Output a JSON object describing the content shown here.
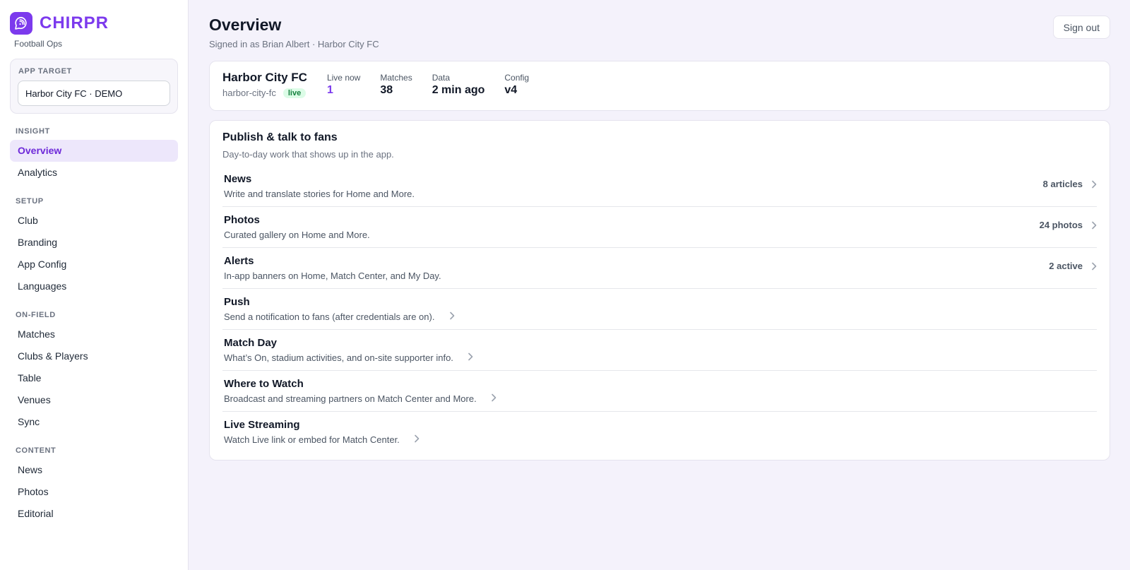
{
  "brand": {
    "name": "CHIRPR",
    "subtitle": "Football Ops",
    "accent": "#7c3aed"
  },
  "app_target": {
    "label": "APP TARGET",
    "value": "Harbor City FC · DEMO"
  },
  "nav": {
    "sections": [
      {
        "title": "INSIGHT",
        "items": [
          {
            "label": "Overview",
            "active": true
          },
          {
            "label": "Analytics"
          }
        ]
      },
      {
        "title": "SETUP",
        "items": [
          {
            "label": "Club"
          },
          {
            "label": "Branding"
          },
          {
            "label": "App Config"
          },
          {
            "label": "Languages"
          }
        ]
      },
      {
        "title": "ON-FIELD",
        "items": [
          {
            "label": "Matches"
          },
          {
            "label": "Clubs & Players"
          },
          {
            "label": "Table"
          },
          {
            "label": "Venues"
          },
          {
            "label": "Sync"
          }
        ]
      },
      {
        "title": "CONTENT",
        "items": [
          {
            "label": "News"
          },
          {
            "label": "Photos"
          },
          {
            "label": "Editorial"
          }
        ]
      }
    ]
  },
  "header": {
    "title": "Overview",
    "subtitle": "Signed in as Brian Albert · Harbor City FC",
    "signout_label": "Sign out"
  },
  "club": {
    "name": "Harbor City FC",
    "slug": "harbor-city-fc",
    "status_badge": "live",
    "stats": [
      {
        "label": "Live now",
        "value": "1",
        "accent": true
      },
      {
        "label": "Matches",
        "value": "38"
      },
      {
        "label": "Data",
        "value": "2 min ago"
      },
      {
        "label": "Config",
        "value": "v4"
      }
    ]
  },
  "publish": {
    "title": "Publish & talk to fans",
    "subtitle": "Day-to-day work that shows up in the app.",
    "rows": [
      {
        "title": "News",
        "desc": "Write and translate stories for Home and More.",
        "count": "8 articles"
      },
      {
        "title": "Photos",
        "desc": "Curated gallery on Home and More.",
        "count": "24 photos"
      },
      {
        "title": "Alerts",
        "desc": "In-app banners on Home, Match Center, and My Day.",
        "count": "2 active"
      },
      {
        "title": "Push",
        "desc": "Send a notification to fans (after credentials are on)."
      },
      {
        "title": "Match Day",
        "desc": "What’s On, stadium activities, and on-site supporter info."
      },
      {
        "title": "Where to Watch",
        "desc": "Broadcast and streaming partners on Match Center and More."
      },
      {
        "title": "Live Streaming",
        "desc": "Watch Live link or embed for Match Center."
      }
    ]
  }
}
